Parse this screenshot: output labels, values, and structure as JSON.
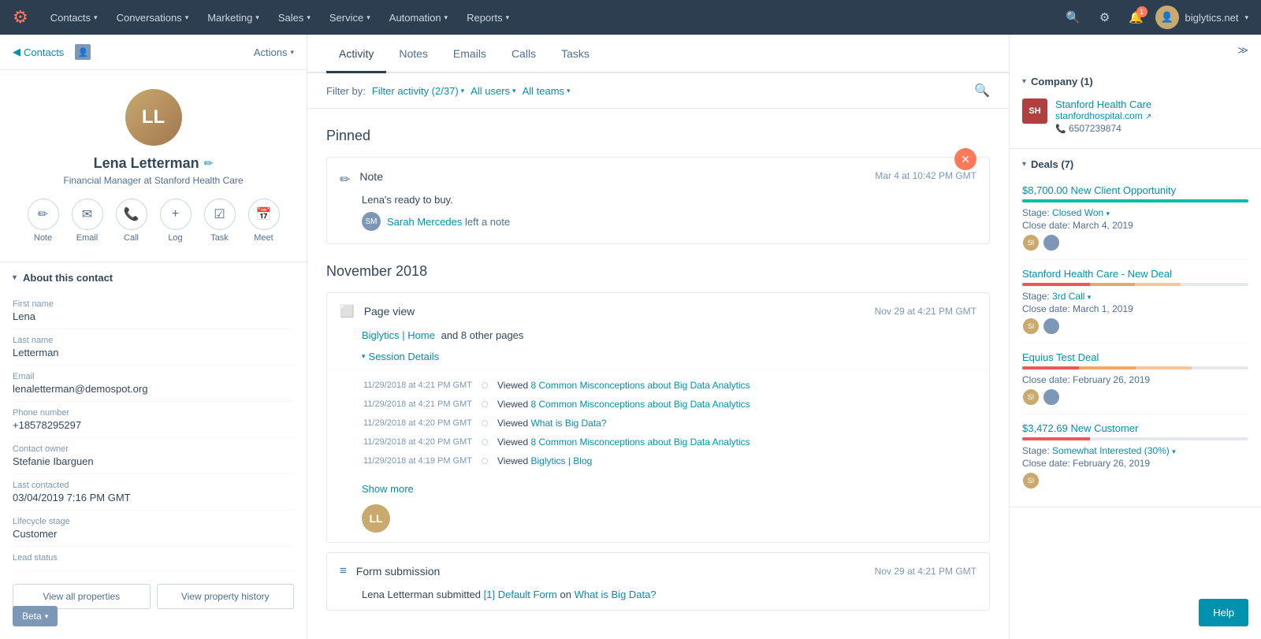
{
  "nav": {
    "logo": "🟠",
    "items": [
      {
        "label": "Contacts",
        "id": "contacts"
      },
      {
        "label": "Conversations",
        "id": "conversations"
      },
      {
        "label": "Marketing",
        "id": "marketing"
      },
      {
        "label": "Sales",
        "id": "sales"
      },
      {
        "label": "Service",
        "id": "service"
      },
      {
        "label": "Automation",
        "id": "automation"
      },
      {
        "label": "Reports",
        "id": "reports"
      }
    ],
    "account": "biglytics.net",
    "notification_count": "1"
  },
  "left_panel": {
    "back_label": "Contacts",
    "actions_label": "Actions",
    "contact": {
      "name": "Lena Letterman",
      "title": "Financial Manager at Stanford Health Care"
    },
    "action_buttons": [
      {
        "icon": "✏️",
        "label": "Note",
        "id": "note"
      },
      {
        "icon": "✉",
        "label": "Email",
        "id": "email"
      },
      {
        "icon": "📞",
        "label": "Call",
        "id": "call"
      },
      {
        "icon": "+",
        "label": "Log",
        "id": "log"
      },
      {
        "icon": "☑",
        "label": "Task",
        "id": "task"
      },
      {
        "icon": "📅",
        "label": "Meet",
        "id": "meet"
      }
    ],
    "about_title": "About this contact",
    "properties": [
      {
        "label": "First name",
        "value": "Lena"
      },
      {
        "label": "Last name",
        "value": "Letterman"
      },
      {
        "label": "Email",
        "value": "lenaletterman@demospot.org"
      },
      {
        "label": "Phone number",
        "value": "+18578295297"
      },
      {
        "label": "Contact owner",
        "value": "Stefanie Ibarguen"
      },
      {
        "label": "Last contacted",
        "value": "03/04/2019 7:16 PM GMT"
      },
      {
        "label": "Lifecycle stage",
        "value": "Customer"
      },
      {
        "label": "Lead status",
        "value": ""
      }
    ],
    "view_all_label": "View all properties",
    "view_history_label": "View property history",
    "beta_label": "Beta"
  },
  "tabs": [
    {
      "label": "Activity",
      "id": "activity",
      "active": true
    },
    {
      "label": "Notes",
      "id": "notes"
    },
    {
      "label": "Emails",
      "id": "emails"
    },
    {
      "label": "Calls",
      "id": "calls"
    },
    {
      "label": "Tasks",
      "id": "tasks"
    }
  ],
  "filter": {
    "label": "Filter by:",
    "activity_filter": "Filter activity (2/37)",
    "users_filter": "All users",
    "teams_filter": "All teams"
  },
  "pinned_section": {
    "title": "Pinned",
    "note": {
      "type": "Note",
      "timestamp": "Mar 4 at 10:42 PM GMT",
      "text": "Lena's ready to buy.",
      "author": "Sarah Mercedes",
      "action": "left a note"
    }
  },
  "month_section": {
    "title": "November 2018",
    "page_view": {
      "type": "Page view",
      "timestamp": "Nov 29 at 4:21 PM GMT",
      "links": "Biglytics | Home",
      "links_suffix": "and 8 other pages",
      "session_toggle": "Session Details",
      "sessions": [
        {
          "time": "11/29/2018 at 4:21 PM GMT",
          "page": "Viewed 8 Common Misconceptions about Big Data Analytics"
        },
        {
          "time": "11/29/2018 at 4:21 PM GMT",
          "page": "Viewed 8 Common Misconceptions about Big Data Analytics"
        },
        {
          "time": "11/29/2018 at 4:20 PM GMT",
          "page": "Viewed What is Big Data?"
        },
        {
          "time": "11/29/2018 at 4:20 PM GMT",
          "page": "Viewed 8 Common Misconceptions about Big Data Analytics"
        },
        {
          "time": "11/29/2018 at 4:19 PM GMT",
          "page": "Viewed Biglytics | Blog"
        }
      ],
      "show_more": "Show more"
    },
    "form_submission": {
      "type": "Form submission",
      "timestamp": "Nov 29 at 4:21 PM GMT",
      "text": "Lena Letterman submitted [1] Default Form on What is Big Data?"
    }
  },
  "right_panel": {
    "company_section": {
      "title": "Company (1)",
      "company": {
        "name": "Stanford Health Care",
        "url": "stanfordhospital.com",
        "phone": "6507239874"
      }
    },
    "deals_section": {
      "title": "Deals (7)",
      "deals": [
        {
          "name": "$8,700.00 New Client Opportunity",
          "stage_label": "Stage:",
          "stage": "Closed Won",
          "close_label": "Close date:",
          "close_date": "March 4, 2019",
          "progress_type": "won"
        },
        {
          "name": "Stanford Health Care - New Deal",
          "stage_label": "Stage:",
          "stage": "3rd Call",
          "close_label": "Close date:",
          "close_date": "March 1, 2019",
          "progress_type": "multi"
        },
        {
          "name": "Equius Test Deal",
          "stage_label": "",
          "stage": "",
          "close_label": "Close date:",
          "close_date": "February 26, 2019",
          "progress_type": "multi2"
        },
        {
          "name": "$3,472.69 New Customer",
          "stage_label": "Stage:",
          "stage": "Somewhat Interested (30%)",
          "close_label": "Close date:",
          "close_date": "February 26, 2019",
          "progress_type": "low"
        }
      ]
    }
  },
  "help_label": "Help"
}
